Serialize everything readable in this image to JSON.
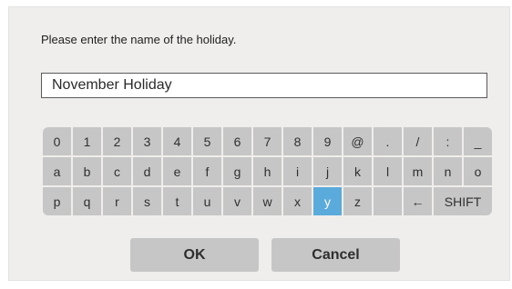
{
  "dialog": {
    "prompt": "Please enter the name of the holiday.",
    "name_value": "November Holiday"
  },
  "keyboard": {
    "rows": [
      [
        "0",
        "1",
        "2",
        "3",
        "4",
        "5",
        "6",
        "7",
        "8",
        "9",
        "@",
        ".",
        "/",
        ":",
        "_"
      ],
      [
        "a",
        "b",
        "c",
        "d",
        "e",
        "f",
        "g",
        "h",
        "i",
        "j",
        "k",
        "l",
        "m",
        "n",
        "o"
      ],
      [
        "p",
        "q",
        "r",
        "s",
        "t",
        "u",
        "v",
        "w",
        "x",
        "y",
        "z",
        "",
        "←",
        "SHIFT"
      ]
    ],
    "selected_key": "y"
  },
  "buttons": {
    "ok": "OK",
    "cancel": "Cancel"
  },
  "colors": {
    "dialog_background": "#f0eeec",
    "key_background": "#c6c6c6",
    "selected_key": "#5aaadb"
  }
}
